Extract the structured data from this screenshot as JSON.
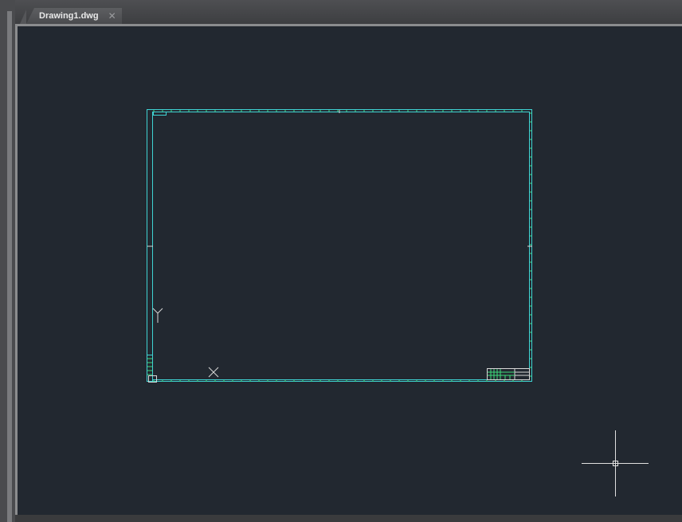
{
  "app": {
    "document_tabs": [
      {
        "label": "Drawing1.dwg",
        "close_icon": "close-icon"
      }
    ]
  },
  "icons": {
    "tab_close": "close-icon",
    "ucs": "ucs-icon",
    "crosshair": "crosshair-cursor-icon"
  },
  "colors": {
    "canvas_bg": "#222830",
    "border_cyan": "#3fd3d3",
    "title_block_green": "#3ddc7a",
    "ucs_white": "#d8d8d8"
  }
}
